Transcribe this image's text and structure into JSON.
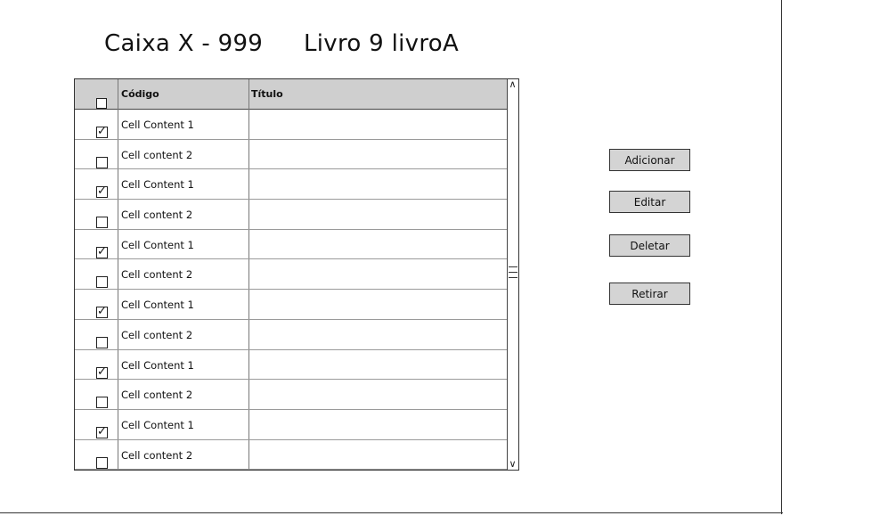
{
  "header": {
    "box_label": "Caixa X - 999",
    "book_label": "Livro 9 livroA"
  },
  "grid": {
    "columns": {
      "select": "",
      "codigo": "Código",
      "titulo": "Título"
    },
    "header_checked": false,
    "rows": [
      {
        "checked": true,
        "codigo": "Cell Content 1",
        "titulo": ""
      },
      {
        "checked": false,
        "codigo": "Cell content 2",
        "titulo": ""
      },
      {
        "checked": true,
        "codigo": "Cell Content 1",
        "titulo": ""
      },
      {
        "checked": false,
        "codigo": "Cell content 2",
        "titulo": ""
      },
      {
        "checked": true,
        "codigo": "Cell Content 1",
        "titulo": ""
      },
      {
        "checked": false,
        "codigo": "Cell content 2",
        "titulo": ""
      },
      {
        "checked": true,
        "codigo": "Cell Content 1",
        "titulo": ""
      },
      {
        "checked": false,
        "codigo": "Cell content 2",
        "titulo": ""
      },
      {
        "checked": true,
        "codigo": "Cell Content 1",
        "titulo": ""
      },
      {
        "checked": false,
        "codigo": "Cell content 2",
        "titulo": ""
      },
      {
        "checked": true,
        "codigo": "Cell Content 1",
        "titulo": ""
      },
      {
        "checked": false,
        "codigo": "Cell content 2",
        "titulo": ""
      }
    ],
    "scroll": {
      "up_icon": "chevron-up-icon",
      "down_icon": "chevron-down-icon"
    }
  },
  "actions": {
    "add_label": "Adicionar",
    "edit_label": "Editar",
    "delete_label": "Deletar",
    "remove_label": "Retirar"
  },
  "colors": {
    "header_bg": "#cfcfcf",
    "button_bg": "#d4d4d4",
    "border": "#333333"
  }
}
